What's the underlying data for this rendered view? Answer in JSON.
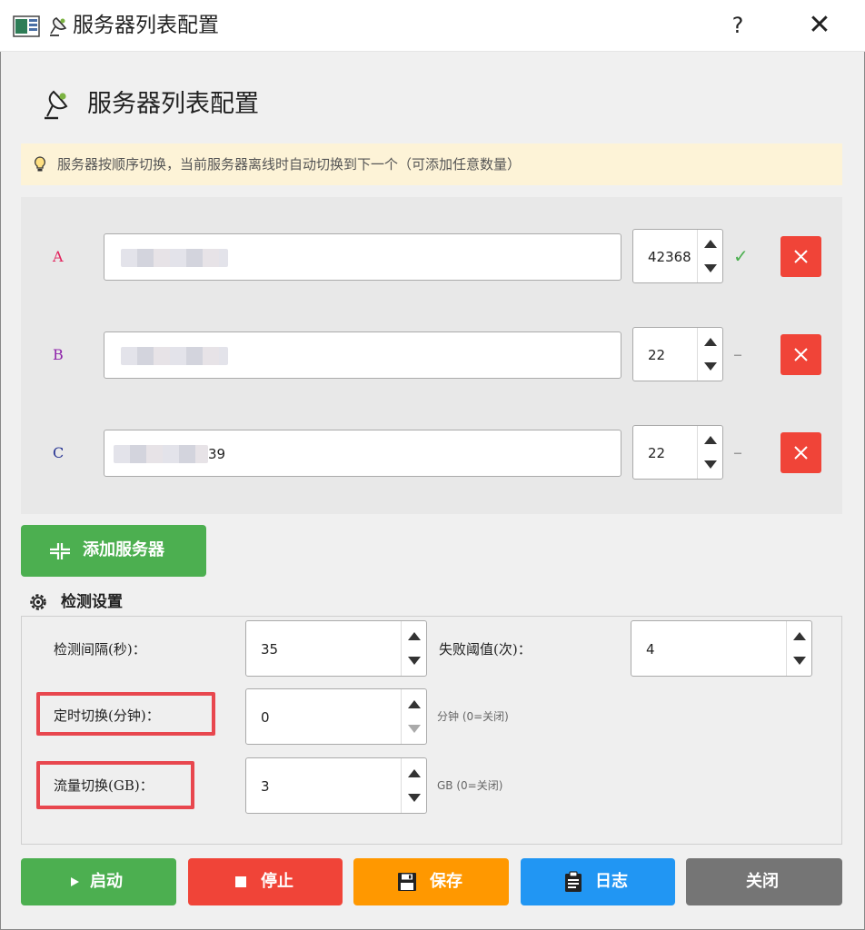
{
  "window": {
    "title": "服务器列表配置",
    "help_glyph": "?",
    "close_glyph": "✕",
    "app_icon": "window-app-icon",
    "title_icon": "satellite-dish-icon"
  },
  "header": {
    "title": "服务器列表配置",
    "icon": "satellite-dish-icon"
  },
  "tip": {
    "icon": "lightbulb-icon",
    "text": "服务器按顺序切换，当前服务器离线时自动切换到下一个（可添加任意数量）"
  },
  "servers": [
    {
      "label": "A",
      "label_color": "#e2225c",
      "host_suffix": "",
      "port": "42368",
      "status": "✓",
      "status_color": "#4caf50"
    },
    {
      "label": "B",
      "label_color": "#8e24aa",
      "host_suffix": "",
      "port": "22",
      "status": "–",
      "status_color": "#999999"
    },
    {
      "label": "C",
      "label_color": "#283593",
      "host_suffix": "39",
      "port": "22",
      "status": "–",
      "status_color": "#999999"
    }
  ],
  "add_button": {
    "label": "添加服务器",
    "icon": "add-server-icon"
  },
  "detection": {
    "title": "检测设置",
    "icon": "gear-icon",
    "interval": {
      "label": "检测间隔(秒)：",
      "value": "35"
    },
    "fail_threshold": {
      "label": "失败阈值(次)：",
      "value": "4"
    },
    "timed_switch": {
      "label": "定时切换(分钟)：",
      "value": "0",
      "hint": "分钟 (0=关闭)"
    },
    "traffic_switch": {
      "label": "流量切换(GB)：",
      "value": "3",
      "hint": "GB (0=关闭)"
    }
  },
  "buttons": {
    "start": {
      "label": "启动",
      "icon": "play-icon",
      "color": "#4caf50"
    },
    "stop": {
      "label": "停止",
      "icon": "stop-icon",
      "color": "#f04438"
    },
    "save": {
      "label": "保存",
      "icon": "floppy-disk-icon",
      "color": "#ff9800"
    },
    "log": {
      "label": "日志",
      "icon": "clipboard-icon",
      "color": "#2196f3"
    },
    "close": {
      "label": "关闭",
      "color": "#757575"
    }
  },
  "colors": {
    "tip_background": "#fdf3d7",
    "highlight_border": "#e8474e",
    "delete_red": "#f04438"
  }
}
